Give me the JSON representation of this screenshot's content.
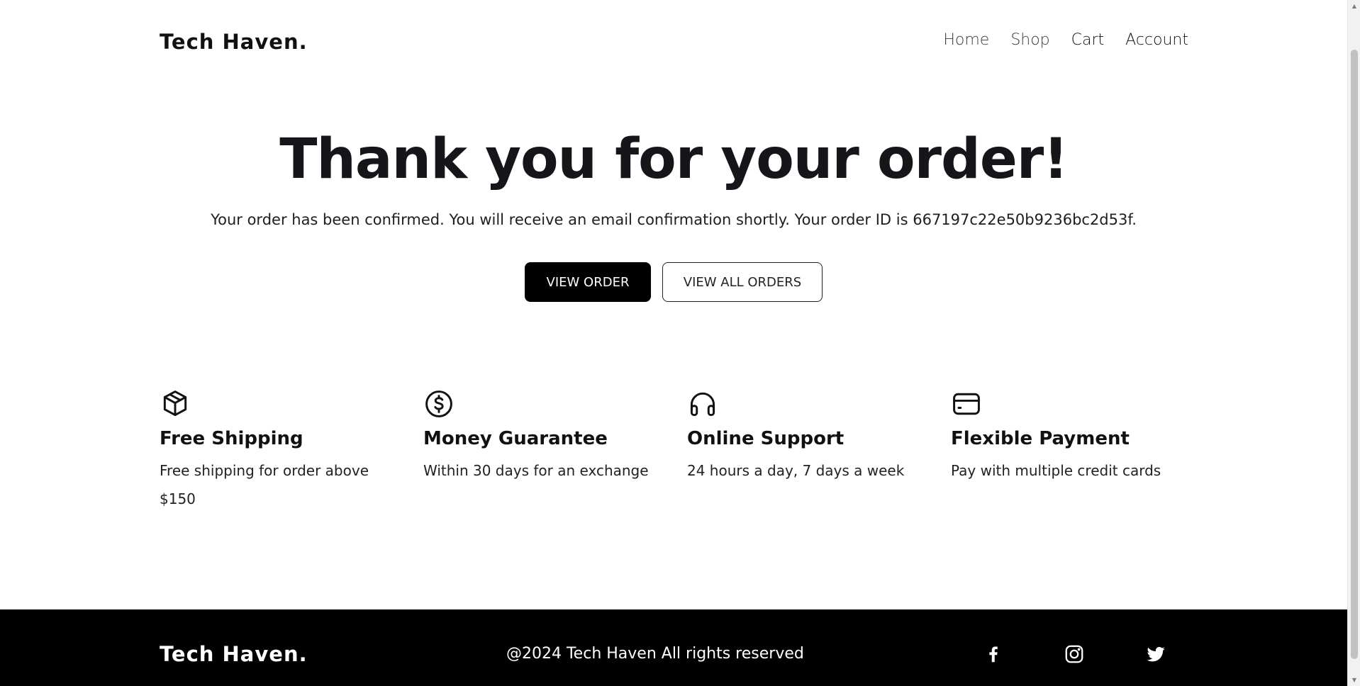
{
  "brand": "Tech Haven.",
  "nav": {
    "items": [
      "Home",
      "Shop",
      "Cart",
      "Account"
    ]
  },
  "hero": {
    "title": "Thank you for your order!",
    "message": "Your order has been confirmed. You will receive an email confirmation shortly. Your order ID is 667197c22e50b9236bc2d53f.",
    "primary_button": "VIEW ORDER",
    "secondary_button": "VIEW ALL ORDERS"
  },
  "features": [
    {
      "icon": "package-icon",
      "title": "Free Shipping",
      "description": "Free shipping for order above $150"
    },
    {
      "icon": "dollar-circle-icon",
      "title": "Money Guarantee",
      "description": "Within 30 days for an exchange"
    },
    {
      "icon": "headphones-icon",
      "title": "Online Support",
      "description": "24 hours a day, 7 days a week"
    },
    {
      "icon": "credit-card-icon",
      "title": "Flexible Payment",
      "description": "Pay with multiple credit cards"
    }
  ],
  "footer": {
    "brand": "Tech Haven.",
    "copyright": "@2024 Tech Haven All rights reserved",
    "social": [
      "facebook-icon",
      "instagram-icon",
      "twitter-icon"
    ]
  },
  "colors": {
    "primary": "#000000",
    "text": "#111111",
    "background": "#ffffff",
    "footer_bg": "#000000",
    "footer_text": "#ffffff"
  }
}
